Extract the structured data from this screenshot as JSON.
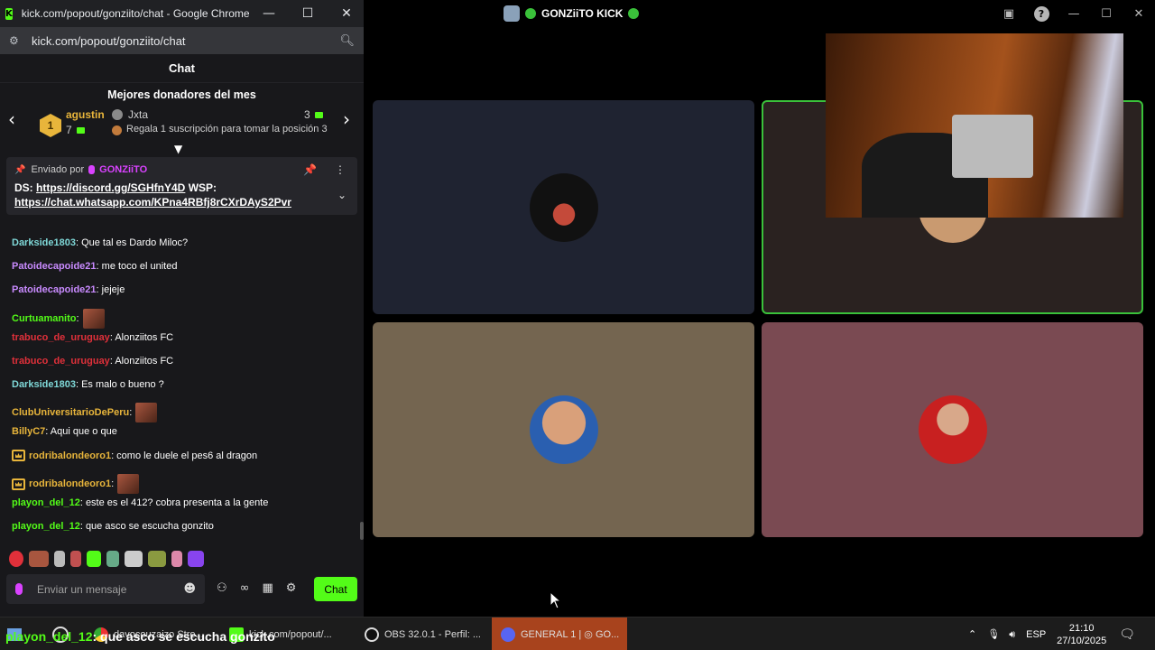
{
  "chrome": {
    "window_title": "kick.com/popout/gonziito/chat - Google Chrome",
    "url": "kick.com/popout/gonziito/chat",
    "win_minimize": "—",
    "win_maximize": "☐",
    "win_close": "✕"
  },
  "chat": {
    "header": "Chat",
    "donors_title": "Mejores donadores del mes",
    "top_donor": {
      "rank": "1",
      "name": "agustin",
      "count": "7"
    },
    "second_donor": {
      "name": "Jxta",
      "count": "3"
    },
    "position_hint": "Regala 1 suscripción para tomar la posición 3",
    "pinned": {
      "sent_by_label": "Enviado por",
      "user": "GONZiiTO",
      "prefix_ds": "DS:",
      "discord_link": "https://discord.gg/SGHfnY4D",
      "prefix_wsp": "WSP:",
      "whatsapp_link": "https://chat.whatsapp.com/KPna4RBfj8rCXrDAyS2Pvr"
    },
    "messages": [
      {
        "user": "Darkside1803",
        "text": ": Que tal es Dardo Miloc?",
        "color": "#7fd8d8"
      },
      {
        "user": "Patoidecapoide21",
        "text": ": me toco el united",
        "color": "#c98bff"
      },
      {
        "user": "Patoidecapoide21",
        "text": ": jejeje",
        "color": "#c98bff"
      },
      {
        "user": "Curtuamanito",
        "text": ":",
        "color": "#53fc18",
        "emote": true
      },
      {
        "user": "trabuco_de_uruguay",
        "text": ": Alonziitos FC",
        "color": "#e0303a"
      },
      {
        "user": "trabuco_de_uruguay",
        "text": ": Alonziitos FC",
        "color": "#e0303a"
      },
      {
        "user": "Darkside1803",
        "text": ": Es malo o bueno ?",
        "color": "#7fd8d8"
      },
      {
        "user": "ClubUniversitarioDePeru",
        "text": ":",
        "color": "#e8b53b",
        "emote": true
      },
      {
        "user": "BillyC7",
        "text": ": Aqui que o que",
        "color": "#e8b53b"
      },
      {
        "user": "rodribalondeoro1",
        "text": ": como le duele el pes6 al dragon",
        "color": "#e8b53b",
        "crown": true
      },
      {
        "user": "rodribalondeoro1",
        "text": ":",
        "color": "#e8b53b",
        "crown": true,
        "emote": true
      },
      {
        "user": "playon_del_12",
        "text": ": este es el 412? cobra presenta a la gente",
        "color": "#53fc18"
      },
      {
        "user": "playon_del_12",
        "text": ": que asco se escucha gonzito",
        "color": "#53fc18"
      }
    ],
    "input_placeholder": "Enviar un mensaje",
    "send_label": "Chat"
  },
  "discord": {
    "title": "GONZiiTO KICK"
  },
  "taskbar": {
    "items": [
      {
        "label": "davocouzaizo Stre..."
      },
      {
        "label": "kick.com/popout/..."
      },
      {
        "label": "OBS 32.0.1 - Perfil: ..."
      },
      {
        "label": "GENERAL 1 | ◎ GO..."
      }
    ],
    "language": "ESP",
    "time": "21:10",
    "date": "27/10/2025"
  },
  "overlay": {
    "user": "playon_del_12",
    "text": ": que asco se escucha gonzito"
  }
}
